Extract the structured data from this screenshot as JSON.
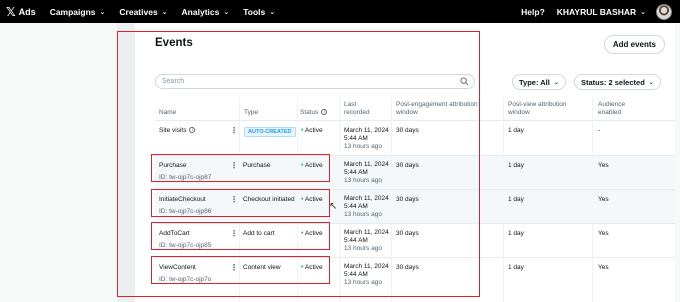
{
  "nav": {
    "logo_x": "𝕏",
    "logo_ads": "Ads",
    "items": [
      "Campaigns",
      "Creatives",
      "Analytics",
      "Tools"
    ],
    "help": "Help?",
    "user": "KHAYRUL BASHAR"
  },
  "page": {
    "title": "Events",
    "add_button": "Add events",
    "search_placeholder": "Search",
    "filter_type": "Type: All",
    "filter_status": "Status: 2 selected"
  },
  "table": {
    "headers": {
      "name": "Name",
      "type": "Type",
      "status": "Status",
      "last_recorded": [
        "Last",
        "recorded"
      ],
      "post_engagement": [
        "Post-engagement attribution",
        "window"
      ],
      "post_view": [
        "Post-view attribution",
        "window"
      ],
      "audience": [
        "Audience",
        "enabled"
      ]
    },
    "rows": [
      {
        "name": "Site visits",
        "id": "",
        "type": "AUTO-CREATED",
        "status": "Active",
        "date": "March 11, 2024",
        "time": "5:44 AM",
        "ago": "13 hours ago",
        "post_engagement": "30 days",
        "post_view": "1 day",
        "audience": "-"
      },
      {
        "name": "Purchase",
        "id": "ID: tw-ojp7c-ojp87",
        "type": "Purchase",
        "status": "Active",
        "date": "March 11, 2024",
        "time": "5:44 AM",
        "ago": "13 hours ago",
        "post_engagement": "30 days",
        "post_view": "1 day",
        "audience": "Yes"
      },
      {
        "name": "InitiateCheckout",
        "id": "ID: tw-ojp7c-ojp86",
        "type": "Checkout initiated",
        "status": "Active",
        "date": "March 11, 2024",
        "time": "5:44 AM",
        "ago": "13 hours ago",
        "post_engagement": "30 days",
        "post_view": "1 day",
        "audience": "Yes"
      },
      {
        "name": "AddToCart",
        "id": "ID: tw-ojp7c-ojp85",
        "type": "Add to cart",
        "status": "Active",
        "date": "March 11, 2024",
        "time": "5:44 AM",
        "ago": "13 hours ago",
        "post_engagement": "30 days",
        "post_view": "1 day",
        "audience": "Yes"
      },
      {
        "name": "ViewContent",
        "id": "ID: tw-ojp7c-ojp7o",
        "type": "Content view",
        "status": "Active",
        "date": "March 11, 2024",
        "time": "5:44 AM",
        "ago": "13 hours ago",
        "post_engagement": "30 days",
        "post_view": "1 day",
        "audience": "Yes"
      }
    ]
  },
  "colors": {
    "highlight": "#e0202a",
    "active": "#00ba7c",
    "badge": "#1d9bf0"
  }
}
